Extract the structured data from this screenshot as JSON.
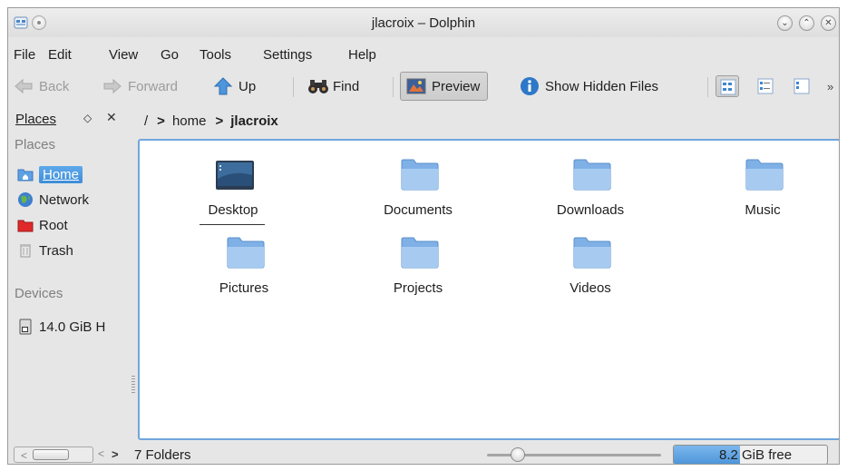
{
  "window": {
    "title": "jlacroix – Dolphin"
  },
  "titlebar_buttons": {
    "minimize": "⌄",
    "maximize": "⌃",
    "close": "✕"
  },
  "menu": [
    "File",
    "Edit",
    "View",
    "Go",
    "Tools",
    "Settings",
    "Help"
  ],
  "toolbar": {
    "back": "Back",
    "forward": "Forward",
    "up": "Up",
    "find": "Find",
    "preview": "Preview",
    "show_hidden": "Show Hidden Files",
    "overflow": "»"
  },
  "places_panel": {
    "title": "Places",
    "float_glyph": "◇",
    "close_glyph": "✕",
    "groups": [
      {
        "label": "Places",
        "items": [
          {
            "label": "Home",
            "icon": "home-folder-icon",
            "selected": true
          },
          {
            "label": "Network",
            "icon": "network-icon"
          },
          {
            "label": "Root",
            "icon": "root-folder-icon"
          },
          {
            "label": "Trash",
            "icon": "trash-icon"
          }
        ]
      },
      {
        "label": "Devices",
        "items": [
          {
            "label": "14.0 GiB H",
            "icon": "hard-drive-icon"
          }
        ]
      }
    ]
  },
  "breadcrumb": {
    "root": "/",
    "sep": ">",
    "parts": [
      "home",
      "jlacroix"
    ]
  },
  "files": [
    {
      "name": "Desktop",
      "icon": "desktop-folder-icon"
    },
    {
      "name": "Documents",
      "icon": "folder-icon"
    },
    {
      "name": "Downloads",
      "icon": "folder-icon"
    },
    {
      "name": "Music",
      "icon": "folder-icon"
    },
    {
      "name": "Pictures",
      "icon": "folder-icon"
    },
    {
      "name": "Projects",
      "icon": "folder-icon"
    },
    {
      "name": "Videos",
      "icon": "folder-icon"
    }
  ],
  "statusbar": {
    "text": "7 Folders",
    "zoom_fraction": 0.15,
    "free_space_label": "8.2 GiB free",
    "used_fraction": 0.43,
    "scroll_left": "<",
    "scroll_right": "<",
    "scroll_right2": ">"
  },
  "colors": {
    "accent": "#3d8dd8",
    "folder": "#6fa8e6",
    "view_border": "#6fa6dc"
  }
}
